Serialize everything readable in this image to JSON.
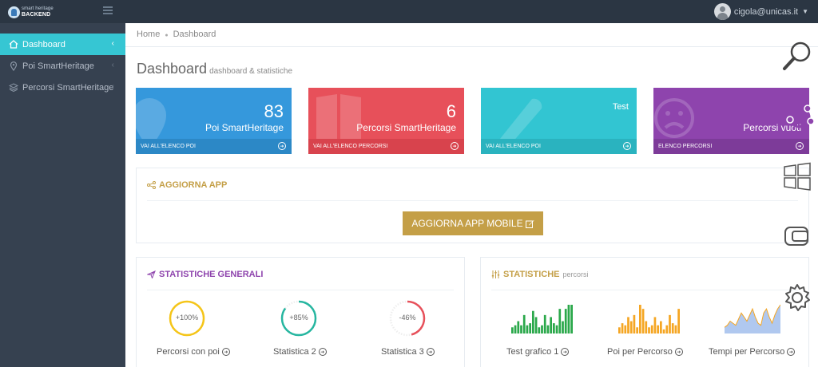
{
  "logo": {
    "small": "smart heritage",
    "big": "BACKEND"
  },
  "user": {
    "email": "cigola@unicas.it"
  },
  "sidebar": {
    "items": [
      {
        "label": "Dashboard",
        "icon": "home-icon"
      },
      {
        "label": "Poi SmartHeritage",
        "icon": "map-pin-icon"
      },
      {
        "label": "Percorsi SmartHeritage",
        "icon": "layers-icon"
      }
    ]
  },
  "breadcrumb": {
    "home": "Home",
    "current": "Dashboard"
  },
  "page": {
    "title": "Dashboard",
    "subtitle": "dashboard & statistiche"
  },
  "cards": [
    {
      "number": "83",
      "label": "Poi SmartHeritage",
      "link": "VAI ALL'ELENCO POI",
      "color": "#3598dc"
    },
    {
      "number": "6",
      "label": "Percorsi SmartHeritage",
      "link": "VAI ALL'ELENCO PERCORSI",
      "color": "#e7505a"
    },
    {
      "number": "",
      "label": "Test",
      "link": "VAI ALL'ELENCO POI",
      "color": "#32c5d2"
    },
    {
      "number": "",
      "label": "Percorsi vuoti",
      "link": "ELENCO PERCORSI",
      "color": "#8e44ad"
    }
  ],
  "update_app": {
    "title": "AGGIORNA APP",
    "button": "AGGIORNA APP MOBILE",
    "color": "#c49f47"
  },
  "stats_general": {
    "title": "STATISTICHE GENERALI",
    "color": "#8e44ad",
    "gauges": [
      {
        "value": "+100%",
        "label": "Percorsi con poi",
        "percent": 100,
        "color": "#f5c518"
      },
      {
        "value": "+85%",
        "label": "Statistica 2",
        "percent": 85,
        "color": "#26b6a0"
      },
      {
        "value": "-46%",
        "label": "Statistica 3",
        "percent": 46,
        "color": "#e7505a"
      }
    ]
  },
  "stats_routes": {
    "title": "STATISTICHE",
    "subtitle": "percorsi",
    "color": "#c49f47",
    "charts": [
      {
        "label": "Test grafico 1",
        "type": "bar",
        "color": "#2aa84a",
        "values": [
          3,
          4,
          6,
          4,
          9,
          4,
          5,
          11,
          8,
          3,
          4,
          9,
          4,
          8,
          5,
          4,
          12,
          6,
          12,
          14,
          14
        ]
      },
      {
        "label": "Poi per Percorso",
        "type": "bar",
        "color": "#f5a623",
        "values": [
          3,
          5,
          4,
          8,
          6,
          9,
          3,
          14,
          12,
          6,
          3,
          4,
          8,
          4,
          6,
          2,
          4,
          9,
          5,
          4,
          12
        ]
      },
      {
        "label": "Tempi per Percorso",
        "type": "area",
        "color": "#8fb0e8",
        "values": [
          3,
          4,
          6,
          5,
          4,
          7,
          10,
          8,
          6,
          9,
          12,
          8,
          5,
          4,
          10,
          12,
          8,
          5,
          9,
          12,
          14
        ]
      }
    ]
  }
}
